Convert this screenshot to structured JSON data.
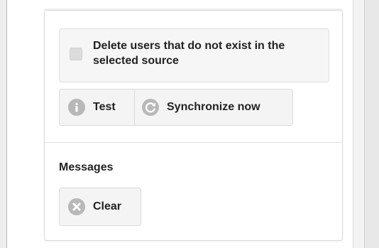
{
  "settings": {
    "delete_missing_label": "Delete users that do not exist in the selected source",
    "delete_missing_checked": false
  },
  "actions": {
    "test_label": "Test",
    "sync_label": "Synchronize now"
  },
  "messages": {
    "heading": "Messages",
    "clear_label": "Clear"
  },
  "icons": {
    "test": "info-icon",
    "sync": "refresh-icon",
    "clear": "clear-icon"
  },
  "colors": {
    "icon_gray": "#b8b8b8",
    "button_bg": "#f4f4f4",
    "checkbox_row_bg": "#f6f6f6"
  }
}
